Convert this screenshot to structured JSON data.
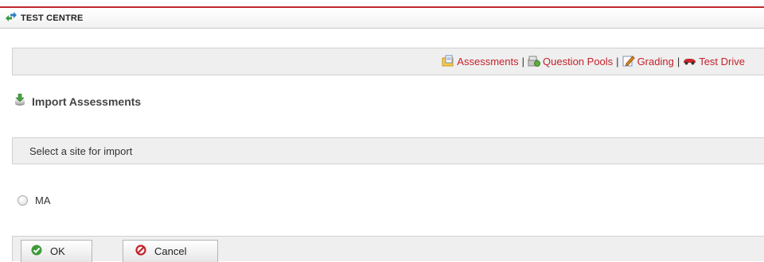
{
  "header": {
    "title": "TEST CENTRE",
    "icon": "arrows-exchange-icon"
  },
  "nav": {
    "items": [
      {
        "label": "Assessments",
        "icon": "folder-document-icon"
      },
      {
        "label": "Question Pools",
        "icon": "database-icon"
      },
      {
        "label": "Grading",
        "icon": "pencil-edit-icon"
      },
      {
        "label": "Test Drive",
        "icon": "car-icon"
      }
    ],
    "separator": "|"
  },
  "section": {
    "heading": "Import Assessments",
    "icon": "import-download-icon"
  },
  "instruction": "Select a site for import",
  "sites": [
    {
      "label": "MA",
      "selected": false
    }
  ],
  "actions": {
    "ok_label": "OK",
    "cancel_label": "Cancel"
  },
  "colors": {
    "accent": "#c3222b",
    "bar_background": "#efefef"
  }
}
